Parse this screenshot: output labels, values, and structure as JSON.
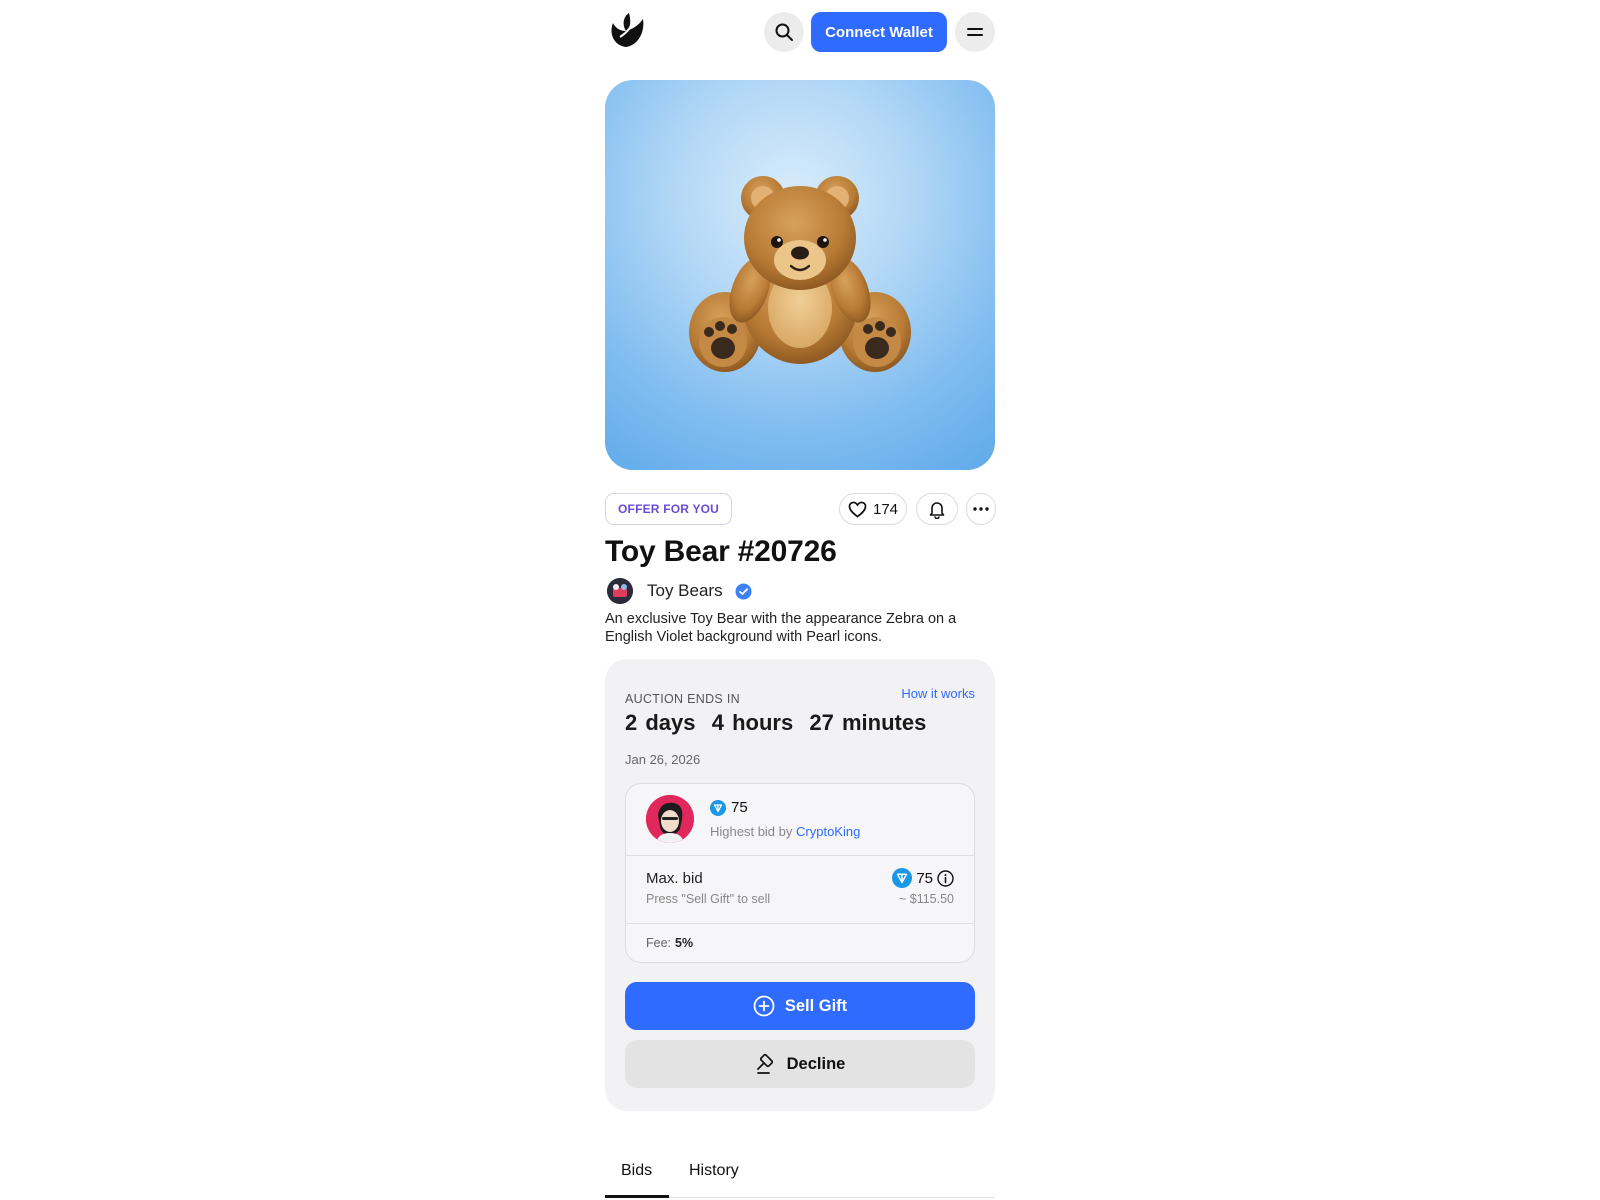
{
  "header": {
    "logo_icon": "leaf-logo-icon",
    "search_icon": "search-icon",
    "connect_label": "Connect Wallet",
    "menu_icon": "menu-icon",
    "accent": "#2f6bff"
  },
  "item": {
    "tag": "OFFER FOR YOU",
    "likes": "174",
    "title": "Toy Bear #20726",
    "collection": "Toy Bears",
    "description": "An exclusive Toy Bear with the appearance Zebra on a English Violet background with Pearl icons."
  },
  "auction": {
    "label": "AUCTION ENDS IN",
    "how_it_works": "How it works",
    "countdown": "2 days  4 hours  27 minutes",
    "date": "Jan 26, 2026",
    "highest_bid_amount": "75",
    "highest_bid_prefix": "Highest bid by",
    "highest_bidder": "CryptoKing",
    "max_bid_label": "Max. bid",
    "max_bid_hint": "Press \"Sell Gift\" to sell",
    "max_bid_amount": "75",
    "max_bid_usd": "~ $115.50",
    "fee_label": "Fee:",
    "fee_value": "5%",
    "sell_label": "Sell Gift",
    "decline_label": "Decline"
  },
  "tabs": {
    "bids": "Bids",
    "history": "History"
  }
}
